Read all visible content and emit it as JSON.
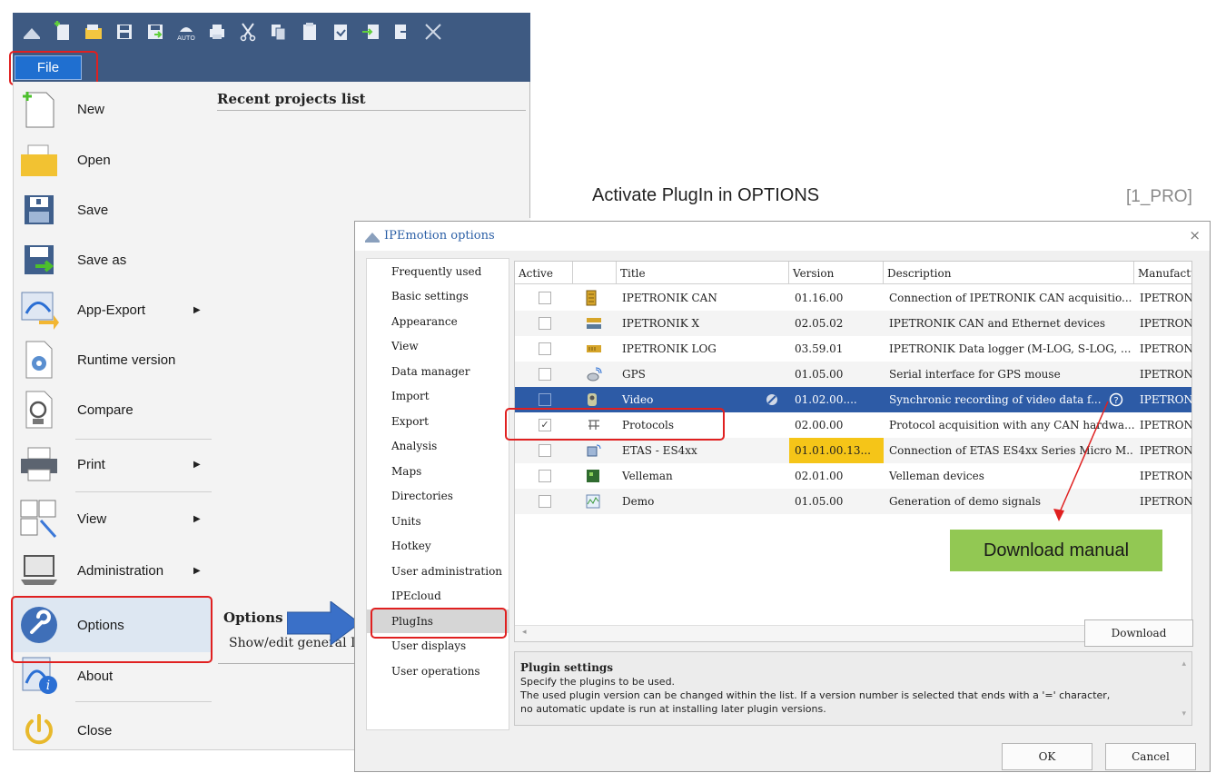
{
  "toolbar": {
    "icons": [
      "app-icon",
      "new-icon",
      "open-icon",
      "save-icon",
      "save-as-icon",
      "auto-icon",
      "print-icon",
      "cut-icon",
      "copy-icon",
      "paste-icon",
      "paste-special-icon",
      "import-icon",
      "export-icon",
      "close-icon"
    ],
    "auto_label": "AUTO"
  },
  "file_button": "File",
  "file_menu": {
    "items": [
      {
        "label": "New",
        "icon": "new-document-icon"
      },
      {
        "label": "Open",
        "icon": "open-folder-icon"
      },
      {
        "label": "Save",
        "icon": "save-disk-icon"
      },
      {
        "label": "Save as",
        "icon": "save-as-disk-icon"
      },
      {
        "label": "App-Export",
        "icon": "app-export-icon",
        "submenu": true
      },
      {
        "label": "Runtime version",
        "icon": "runtime-version-icon"
      },
      {
        "label": "Compare",
        "icon": "compare-icon"
      },
      {
        "label": "Print",
        "icon": "printer-icon",
        "submenu": true
      },
      {
        "label": "View",
        "icon": "view-icon",
        "submenu": true
      },
      {
        "label": "Administration",
        "icon": "laptop-icon",
        "submenu": true
      },
      {
        "label": "Options",
        "icon": "wrench-icon",
        "selected": true
      },
      {
        "label": "About",
        "icon": "about-icon"
      },
      {
        "label": "Close",
        "icon": "power-icon"
      }
    ],
    "recent_projects_title": "Recent projects list",
    "options_submenu": {
      "title": "Options",
      "description": "Show/edit general I"
    }
  },
  "heading": "Activate PlugIn in OPTIONS",
  "heading_tag": "[1_PRO]",
  "dialog": {
    "title": "IPEmotion options",
    "close": "×",
    "nav": [
      "Frequently used",
      "Basic settings",
      "Appearance",
      "View",
      "Data manager",
      "Import",
      "Export",
      "Analysis",
      "Maps",
      "Directories",
      "Units",
      "Hotkey",
      "User administration",
      "IPEcloud",
      "PlugIns",
      "User displays",
      "User operations"
    ],
    "nav_selected": "PlugIns",
    "columns": {
      "active": "Active",
      "icon": "",
      "title": "Title",
      "version": "Version",
      "description": "Description",
      "manufacturer": "Manufactu"
    },
    "rows": [
      {
        "active": false,
        "title": "IPETRONIK CAN",
        "version": "01.16.00",
        "description": "Connection of IPETRONIK CAN acquisitio...",
        "manufacturer": "IPETRONI"
      },
      {
        "active": false,
        "title": "IPETRONIK X",
        "version": "02.05.02",
        "description": "IPETRONIK CAN and Ethernet devices",
        "manufacturer": "IPETRONI"
      },
      {
        "active": false,
        "title": "IPETRONIK LOG",
        "version": "03.59.01",
        "description": "IPETRONIK Data logger (M-LOG, S-LOG, ...",
        "manufacturer": "IPETRONI"
      },
      {
        "active": false,
        "title": "GPS",
        "version": "01.05.00",
        "description": "Serial interface for GPS mouse",
        "manufacturer": "IPETRONI"
      },
      {
        "active": false,
        "title": "Video",
        "version": "01.02.00....",
        "description": "Synchronic recording of video data f...",
        "manufacturer": "IPETRONI",
        "selected": true
      },
      {
        "active": true,
        "title": "Protocols",
        "version": "02.00.00",
        "description": "Protocol acquisition with any CAN hardwa...",
        "manufacturer": "IPETRONI"
      },
      {
        "active": false,
        "title": "ETAS - ES4xx",
        "version": "01.01.00.13...",
        "description": "Connection of ETAS ES4xx Series Micro M...",
        "manufacturer": "IPETRONI",
        "version_highlight": true
      },
      {
        "active": false,
        "title": "Velleman",
        "version": "02.01.00",
        "description": "Velleman devices",
        "manufacturer": "IPETRONI"
      },
      {
        "active": false,
        "title": "Demo",
        "version": "01.05.00",
        "description": "Generation of demo signals",
        "manufacturer": "IPETRONI"
      }
    ],
    "download_button": "Download",
    "settings": {
      "title": "Plugin settings",
      "line1": "Specify the plugins to be used.",
      "line2": "The used plugin version can be changed within the list. If a version number is selected that ends with a '=' character,",
      "line3": "no automatic update is run at installing later plugin versions."
    },
    "ok_button": "OK",
    "cancel_button": "Cancel"
  },
  "callout": "Download manual",
  "colors": {
    "toolbar": "#3e5a82",
    "file_button": "#1f6fd0",
    "highlight_red": "#e02020",
    "selected_row": "#2d5ba6",
    "version_highlight": "#f5c518",
    "callout_green": "#92c853",
    "arrow_blue": "#3a70c8"
  }
}
